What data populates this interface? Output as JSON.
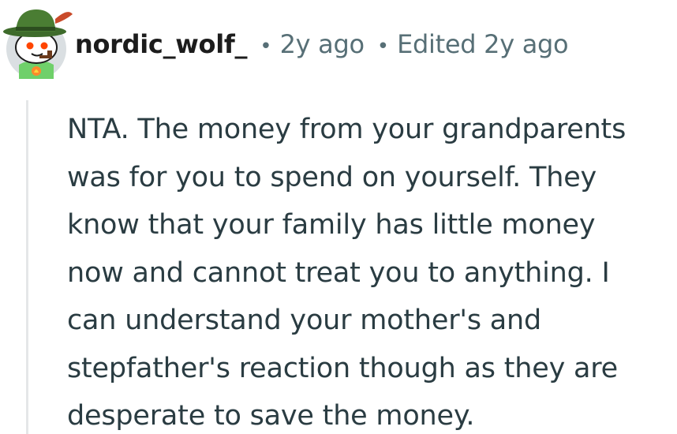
{
  "comment": {
    "author": "nordic_wolf_",
    "separator": "•",
    "posted": "2y ago",
    "edited": "Edited 2y ago",
    "avatar_icon": "reddit-snoo-avatar-icon",
    "lines": [
      "NTA. The money from your grandparents",
      "was for you to spend on yourself. They",
      "know that your family has little money",
      "now and cannot treat you to anything. I",
      "can understand your mother's and",
      "stepfather's reaction though as they are",
      "desperate to save the money."
    ]
  },
  "colors": {
    "text": "#2a3c42",
    "meta": "#576f76",
    "thread_line": "#e5e7e8",
    "avatar_bg": "#dadfe2",
    "hat": "#3e6b2b",
    "shirt": "#6fd06a"
  }
}
